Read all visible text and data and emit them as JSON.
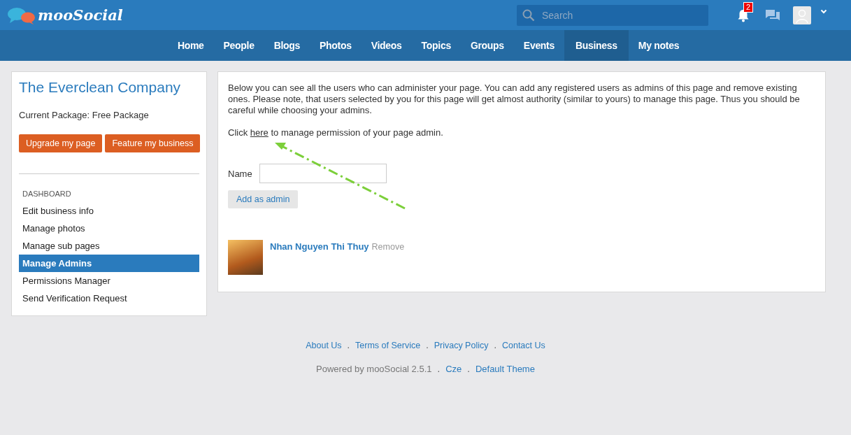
{
  "header": {
    "logo": "mooSocial",
    "search": {
      "placeholder": "Search"
    },
    "notifications_badge": "2"
  },
  "nav": [
    {
      "label": "Home",
      "selected": false
    },
    {
      "label": "People",
      "selected": false
    },
    {
      "label": "Blogs",
      "selected": false
    },
    {
      "label": "Photos",
      "selected": false
    },
    {
      "label": "Videos",
      "selected": false
    },
    {
      "label": "Topics",
      "selected": false
    },
    {
      "label": "Groups",
      "selected": false
    },
    {
      "label": "Events",
      "selected": false
    },
    {
      "label": "Business",
      "selected": true
    },
    {
      "label": "My notes",
      "selected": false
    }
  ],
  "sidebar": {
    "title": "The Everclean Company",
    "package": "Current Package: Free Package",
    "buttons": [
      "Upgrade my page",
      "Feature my business"
    ],
    "section": "DASHBOARD",
    "items": [
      {
        "label": "Edit business info",
        "selected": false
      },
      {
        "label": "Manage photos",
        "selected": false
      },
      {
        "label": "Manage sub pages",
        "selected": false
      },
      {
        "label": "Manage Admins",
        "selected": true
      },
      {
        "label": "Permissions Manager",
        "selected": false
      },
      {
        "label": "Send Verification Request",
        "selected": false
      }
    ]
  },
  "content": {
    "intro": "Below you can see all the users who can administer your page. You can add any registered users as admins of this page and remove existing ones. Please note, that users selected by you for this page will get almost authority (similar to yours) to manage this page. Thus you should be careful while choosing your admins.",
    "permission": {
      "before": "Click ",
      "link": "here",
      "after": " to manage permission of your page admin."
    },
    "name_label": "Name",
    "add_button": "Add as admin",
    "admins": [
      {
        "name": "Nhan Nguyen Thi Thuy",
        "action": "Remove"
      }
    ]
  },
  "footer": {
    "links": [
      {
        "kind": "link",
        "text": "About Us"
      },
      {
        "kind": "sep",
        "text": "."
      },
      {
        "kind": "link",
        "text": "Terms of Service"
      },
      {
        "kind": "sep",
        "text": "."
      },
      {
        "kind": "link",
        "text": "Privacy Policy"
      },
      {
        "kind": "sep",
        "text": "."
      },
      {
        "kind": "link",
        "text": "Contact Us"
      }
    ],
    "credits": [
      {
        "kind": "text",
        "text": "Powered by mooSocial 2.5.1"
      },
      {
        "kind": "sep",
        "text": "."
      },
      {
        "kind": "link",
        "text": "Cze"
      },
      {
        "kind": "sep",
        "text": "."
      },
      {
        "kind": "link",
        "text": "Default Theme"
      }
    ]
  }
}
